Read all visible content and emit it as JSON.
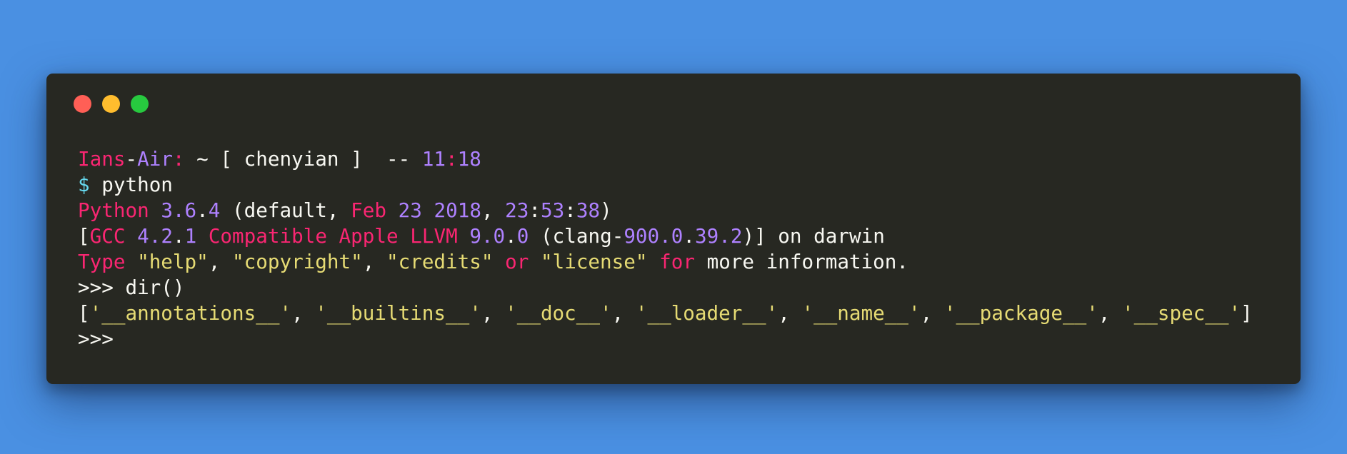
{
  "colors": {
    "page_background": "#4a90e2",
    "window_background": "#272822",
    "default": "#f8f8f2",
    "pink": "#f92672",
    "purple": "#ae81ff",
    "yellow": "#e6db74",
    "cyan": "#66d9ef",
    "close": "#ff5f56",
    "minimize": "#ffbd2e",
    "maximize": "#27c93f"
  },
  "window_controls": [
    {
      "name": "close",
      "color": "#ff5f56"
    },
    {
      "name": "minimize",
      "color": "#ffbd2e"
    },
    {
      "name": "maximize",
      "color": "#27c93f"
    }
  ],
  "terminal": {
    "lines": [
      [
        {
          "t": "Ians",
          "c": "pink"
        },
        {
          "t": "-",
          "c": "default"
        },
        {
          "t": "Air",
          "c": "purple"
        },
        {
          "t": ":",
          "c": "pink"
        },
        {
          "t": " ~ [ chenyian ]  -- ",
          "c": "default"
        },
        {
          "t": "11",
          "c": "purple"
        },
        {
          "t": ":",
          "c": "pink"
        },
        {
          "t": "18",
          "c": "purple"
        }
      ],
      [
        {
          "t": "$",
          "c": "cyan"
        },
        {
          "t": " python",
          "c": "default"
        }
      ],
      [
        {
          "t": "Python",
          "c": "pink"
        },
        {
          "t": " ",
          "c": "default"
        },
        {
          "t": "3.6",
          "c": "purple"
        },
        {
          "t": ".",
          "c": "default"
        },
        {
          "t": "4",
          "c": "purple"
        },
        {
          "t": " (default, ",
          "c": "default"
        },
        {
          "t": "Feb",
          "c": "pink"
        },
        {
          "t": " ",
          "c": "default"
        },
        {
          "t": "23",
          "c": "purple"
        },
        {
          "t": " ",
          "c": "default"
        },
        {
          "t": "2018",
          "c": "purple"
        },
        {
          "t": ", ",
          "c": "default"
        },
        {
          "t": "23",
          "c": "purple"
        },
        {
          "t": ":",
          "c": "default"
        },
        {
          "t": "53",
          "c": "purple"
        },
        {
          "t": ":",
          "c": "default"
        },
        {
          "t": "38",
          "c": "purple"
        },
        {
          "t": ")",
          "c": "default"
        }
      ],
      [
        {
          "t": "[",
          "c": "default"
        },
        {
          "t": "GCC",
          "c": "pink"
        },
        {
          "t": " ",
          "c": "default"
        },
        {
          "t": "4.2",
          "c": "purple"
        },
        {
          "t": ".",
          "c": "default"
        },
        {
          "t": "1",
          "c": "purple"
        },
        {
          "t": " ",
          "c": "default"
        },
        {
          "t": "Compatible Apple LLVM",
          "c": "pink"
        },
        {
          "t": " ",
          "c": "default"
        },
        {
          "t": "9.0",
          "c": "purple"
        },
        {
          "t": ".",
          "c": "default"
        },
        {
          "t": "0",
          "c": "purple"
        },
        {
          "t": " (clang-",
          "c": "default"
        },
        {
          "t": "900.0",
          "c": "purple"
        },
        {
          "t": ".",
          "c": "default"
        },
        {
          "t": "39.2",
          "c": "purple"
        },
        {
          "t": ")] on darwin",
          "c": "default"
        }
      ],
      [
        {
          "t": "Type",
          "c": "pink"
        },
        {
          "t": " ",
          "c": "default"
        },
        {
          "t": "\"help\"",
          "c": "yellow"
        },
        {
          "t": ", ",
          "c": "default"
        },
        {
          "t": "\"copyright\"",
          "c": "yellow"
        },
        {
          "t": ", ",
          "c": "default"
        },
        {
          "t": "\"credits\"",
          "c": "yellow"
        },
        {
          "t": " ",
          "c": "default"
        },
        {
          "t": "or",
          "c": "pink"
        },
        {
          "t": " ",
          "c": "default"
        },
        {
          "t": "\"license\"",
          "c": "yellow"
        },
        {
          "t": " ",
          "c": "default"
        },
        {
          "t": "for",
          "c": "pink"
        },
        {
          "t": " more information.",
          "c": "default"
        }
      ],
      [
        {
          "t": ">>> dir()",
          "c": "default"
        }
      ],
      [
        {
          "t": "[",
          "c": "default"
        },
        {
          "t": "'__annotations__'",
          "c": "yellow"
        },
        {
          "t": ", ",
          "c": "default"
        },
        {
          "t": "'__builtins__'",
          "c": "yellow"
        },
        {
          "t": ", ",
          "c": "default"
        },
        {
          "t": "'__doc__'",
          "c": "yellow"
        },
        {
          "t": ", ",
          "c": "default"
        },
        {
          "t": "'__loader__'",
          "c": "yellow"
        },
        {
          "t": ", ",
          "c": "default"
        },
        {
          "t": "'__name__'",
          "c": "yellow"
        },
        {
          "t": ", ",
          "c": "default"
        },
        {
          "t": "'__package__'",
          "c": "yellow"
        },
        {
          "t": ", ",
          "c": "default"
        },
        {
          "t": "'__spec__'",
          "c": "yellow"
        },
        {
          "t": "]",
          "c": "default"
        }
      ],
      [
        {
          "t": ">>>",
          "c": "default"
        }
      ]
    ]
  }
}
